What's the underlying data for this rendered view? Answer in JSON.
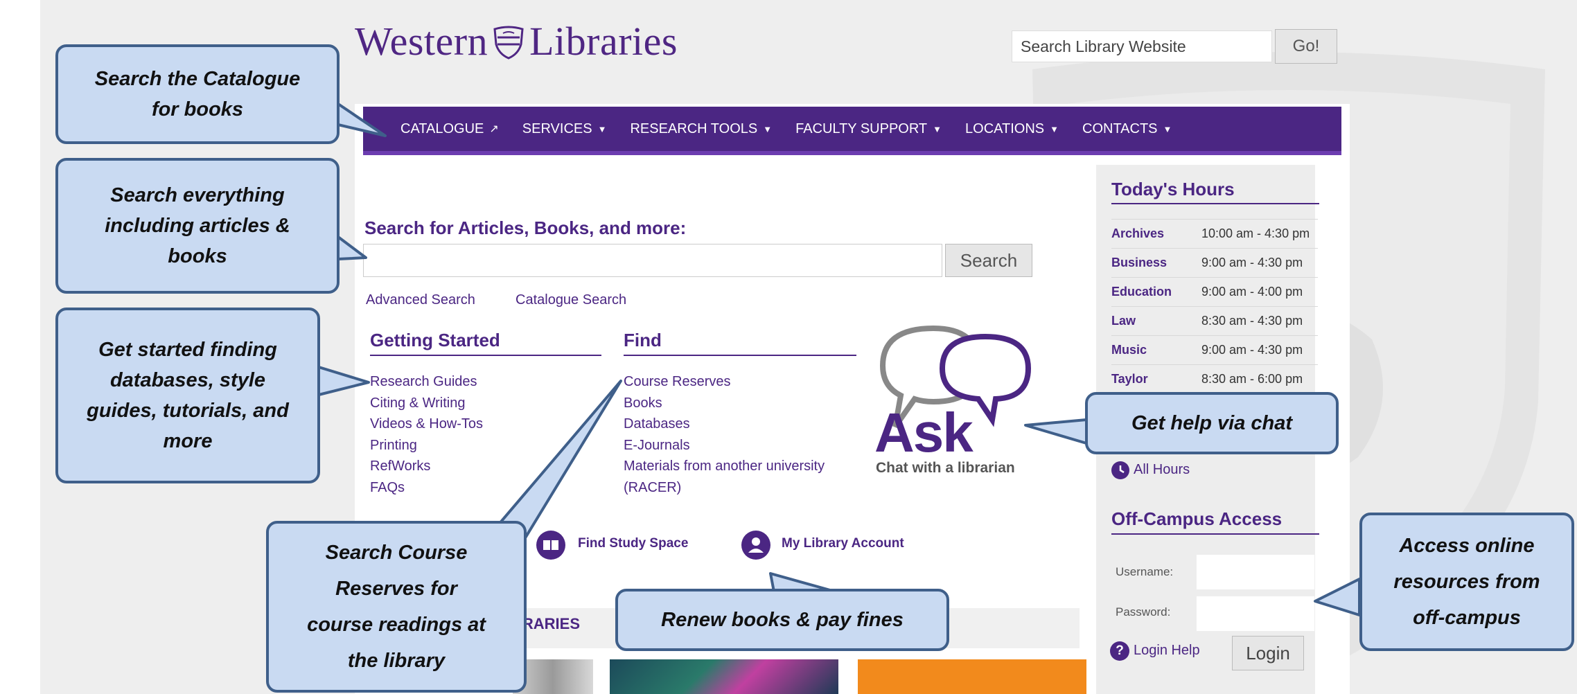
{
  "header": {
    "logo_left": "Western",
    "logo_right": "Libraries",
    "site_search_placeholder": "Search Library Website",
    "go_label": "Go!"
  },
  "nav": {
    "items": [
      {
        "label": "CATALOGUE",
        "icon": "external-link-icon"
      },
      {
        "label": "SERVICES",
        "icon": "caret-down-icon"
      },
      {
        "label": "RESEARCH TOOLS",
        "icon": "caret-down-icon"
      },
      {
        "label": "FACULTY SUPPORT",
        "icon": "caret-down-icon"
      },
      {
        "label": "LOCATIONS",
        "icon": "caret-down-icon"
      },
      {
        "label": "CONTACTS",
        "icon": "caret-down-icon"
      }
    ]
  },
  "main": {
    "search_heading": "Search for Articles, Books, and more:",
    "search_value": "",
    "search_button": "Search",
    "advanced_search": "Advanced Search",
    "catalogue_search": "Catalogue Search",
    "getting_started": {
      "title": "Getting Started",
      "links": [
        "Research Guides",
        "Citing & Writing",
        "Videos & How-Tos",
        "Printing",
        "RefWorks",
        "FAQs"
      ]
    },
    "find": {
      "title": "Find",
      "links": [
        "Course Reserves",
        "Books",
        "Databases",
        "E-Journals",
        "Materials from another university",
        "(RACER)"
      ]
    },
    "ask": {
      "word": "Ask",
      "sub": "Chat with a librarian"
    },
    "quick_links": {
      "study_space": "Find Study Space",
      "account": "My Library Account"
    },
    "news_heading": "BRARIES"
  },
  "sidebar": {
    "hours_title": "Today's Hours",
    "hours": [
      {
        "library": "Archives",
        "time": "10:00 am - 4:30 pm"
      },
      {
        "library": "Business",
        "time": "9:00 am - 4:30 pm"
      },
      {
        "library": "Education",
        "time": "9:00 am - 4:00 pm"
      },
      {
        "library": "Law",
        "time": "8:30 am - 4:30 pm"
      },
      {
        "library": "Music",
        "time": "9:00 am - 4:30 pm"
      },
      {
        "library": "Taylor",
        "time": "8:30 am - 6:00 pm"
      }
    ],
    "all_hours": "All Hours",
    "off_campus_title": "Off-Campus Access",
    "username_label": "Username:",
    "password_label": "Password:",
    "login_help": "Login Help",
    "login_button": "Login"
  },
  "callouts": {
    "catalogue": [
      "Search the Catalogue",
      "for books"
    ],
    "everything": [
      "Search everything",
      "including articles &",
      "books"
    ],
    "getting_started": [
      "Get started finding",
      "databases, style",
      "guides, tutorials, and",
      "more"
    ],
    "course_reserves": [
      "Search Course",
      "Reserves for",
      "course readings at",
      "the library"
    ],
    "renew": [
      "Renew books & pay fines"
    ],
    "chat": [
      "Get help via chat"
    ],
    "off_campus": [
      "Access online",
      "resources from",
      "off-campus"
    ]
  },
  "colors": {
    "brand_purple": "#4b2683",
    "callout_fill": "#c9daf2",
    "callout_border": "#3f5f8a"
  }
}
